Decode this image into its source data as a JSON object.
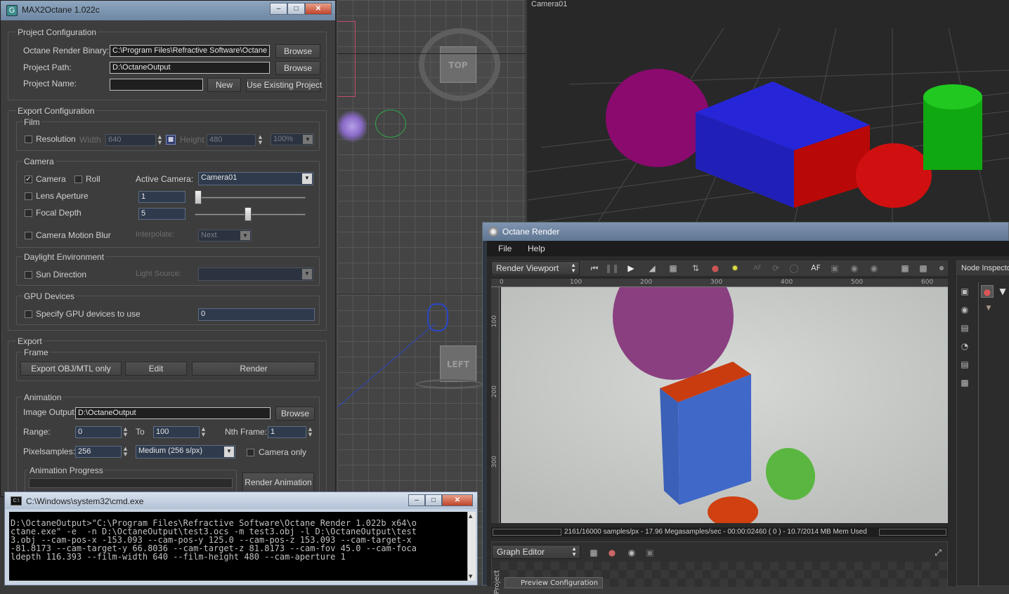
{
  "viewports": {
    "perspective_label": "Camera01",
    "top_cube_label": "TOP",
    "left_cube_label": "LEFT"
  },
  "max2octane": {
    "title": "MAX2Octane 1.022c",
    "project_config": {
      "group": "Project Configuration",
      "binary_label": "Octane Render Binary:",
      "binary_value": "C:\\Program Files\\Refractive Software\\Octane",
      "path_label": "Project Path:",
      "path_value": "D:\\OctaneOutput",
      "name_label": "Project Name:",
      "name_value": "",
      "browse": "Browse",
      "new": "New",
      "use_existing": "Use Existing Project"
    },
    "export_config": {
      "group": "Export Configuration",
      "film": {
        "group": "Film",
        "resolution": "Resolution",
        "width_label": "Width",
        "width_value": "640",
        "height_label": "Height",
        "height_value": "480",
        "percent": "100%"
      },
      "camera": {
        "group": "Camera",
        "camera": "Camera",
        "roll": "Roll",
        "active_camera_label": "Active Camera:",
        "active_camera_value": "Camera01",
        "lens_aperture": "Lens Aperture",
        "lens_aperture_value": "1",
        "lens_aperture_slider": 0.0,
        "focal_depth": "Focal Depth",
        "focal_depth_value": "5",
        "focal_depth_slider": 0.48,
        "motion_blur": "Camera Motion Blur",
        "interpolate_label": "Interpolate:",
        "interpolate_value": "Next"
      },
      "daylight": {
        "group": "Daylight Environment",
        "sun_direction": "Sun Direction",
        "light_source_label": "Light Source:",
        "light_source_value": ""
      },
      "gpu": {
        "group": "GPU Devices",
        "specify": "Specify GPU devices to use",
        "value": "0"
      }
    },
    "export": {
      "group": "Export",
      "frame": {
        "group": "Frame",
        "export_obj": "Export OBJ/MTL only",
        "edit": "Edit",
        "render": "Render"
      },
      "animation": {
        "group": "Animation",
        "image_output_label": "Image Output:",
        "image_output_value": "D:\\OctaneOutput",
        "browse": "Browse",
        "range_label": "Range:",
        "range_from": "0",
        "to_label": "To",
        "range_to": "100",
        "nth_label": "Nth Frame:",
        "nth_value": "1",
        "pixelsamples_label": "Pixelsamples:",
        "pixelsamples_value": "256",
        "quality_value": "Medium (256 s/px)",
        "camera_only": "Camera only",
        "progress_group": "Animation Progress",
        "render_animation": "Render Animation"
      }
    }
  },
  "cmd": {
    "title": "C:\\Windows\\system32\\cmd.exe",
    "text": "D:\\OctaneOutput>\"C:\\Program Files\\Refractive Software\\Octane Render 1.022b x64\\o\nctane.exe\" -e  -n D:\\OctaneOutput\\test3.ocs -m test3.obj -l D:\\OctaneOutput\\test\n3.obj --cam-pos-x -153.093 --cam-pos-y 125.0 --cam-pos-z 153.093 --cam-target-x\n-81.8173 --cam-target-y 66.8036 --cam-target-z 81.8173 --cam-fov 45.0 --cam-foca\nldepth 116.393 --film-width 640 --film-height 480 --cam-aperture 1"
  },
  "octane": {
    "title": "Octane Render",
    "menu": [
      "File",
      "Help"
    ],
    "viewport_combo": "Render Viewport",
    "af_label": "AF",
    "ruler_h": [
      "0",
      "100",
      "200",
      "300",
      "400",
      "500",
      "600"
    ],
    "ruler_v": [
      "100",
      "200",
      "300"
    ],
    "status": "2161/16000 samples/px - 17.96 Megasamples/sec - 00:00:02460 ( 0 ) - 10.7/2014 MB Mem Used",
    "graph_editor": "Graph Editor",
    "preview_configuration": "Preview Configuration",
    "project_tab": "Project",
    "node_inspector": "Node Inspector"
  }
}
